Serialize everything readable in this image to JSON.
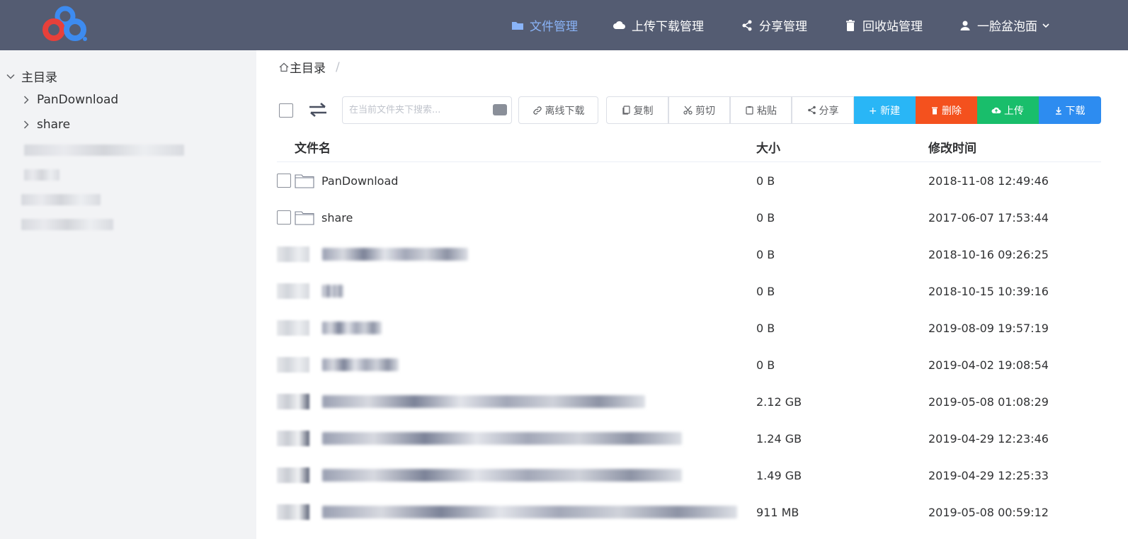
{
  "nav": {
    "files": "文件管理",
    "transfers": "上传下载管理",
    "share": "分享管理",
    "recycle": "回收站管理",
    "user": "一脸盆泡面"
  },
  "sidebar": {
    "root": "主目录",
    "items": [
      {
        "label": "PanDownload"
      },
      {
        "label": "share"
      }
    ]
  },
  "breadcrumb": {
    "home": "主目录",
    "separator": "/"
  },
  "toolbar": {
    "search_placeholder": "在当前文件夹下搜索...",
    "offline": "离线下载",
    "copy": "复制",
    "cut": "剪切",
    "paste": "粘贴",
    "share": "分享",
    "new": "+ 新建",
    "delete": "删除",
    "upload": "上传",
    "download": "下载"
  },
  "table": {
    "headers": {
      "name": "文件名",
      "size": "大小",
      "modified": "修改时间"
    },
    "rows": [
      {
        "name": "PanDownload",
        "size": "0 B",
        "modified": "2018-11-08 12:49:46"
      },
      {
        "name": "share",
        "size": "0 B",
        "modified": "2017-06-07 17:53:44"
      },
      {
        "name": "",
        "size": "0 B",
        "modified": "2018-10-16 09:26:25"
      },
      {
        "name": "",
        "size": "0 B",
        "modified": "2018-10-15 10:39:16"
      },
      {
        "name": "",
        "size": "0 B",
        "modified": "2019-08-09 19:57:19"
      },
      {
        "name": "",
        "size": "0 B",
        "modified": "2019-04-02 19:08:54"
      },
      {
        "name": "",
        "size": "2.12 GB",
        "modified": "2019-05-08 01:08:29"
      },
      {
        "name": "",
        "size": "1.24 GB",
        "modified": "2019-04-29 12:23:46"
      },
      {
        "name": "",
        "size": "1.49 GB",
        "modified": "2019-04-29 12:25:33"
      },
      {
        "name": "",
        "size": "911 MB",
        "modified": "2019-05-08 00:59:12"
      }
    ]
  },
  "colors": {
    "topbar": "#545c72",
    "nav_active": "#8ab4f8",
    "new": "#29b6f6",
    "delete": "#f4511e",
    "upload": "#19be6b",
    "download": "#2d8cf0"
  }
}
